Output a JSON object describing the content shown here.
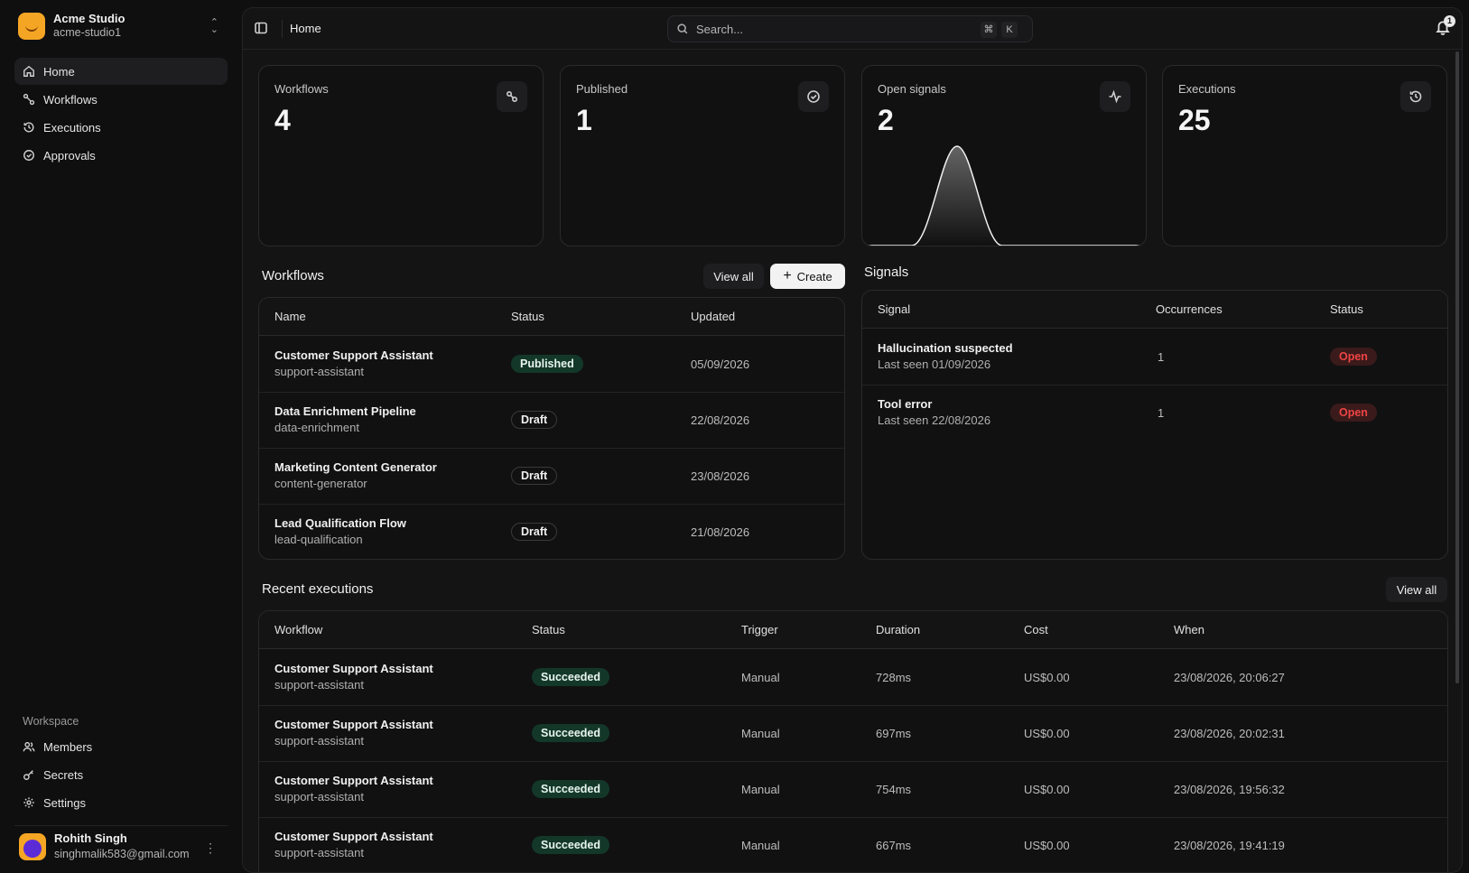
{
  "team": {
    "name": "Acme Studio",
    "slug": "acme-studio1"
  },
  "nav": [
    {
      "label": "Home",
      "icon": "home-icon",
      "active": true
    },
    {
      "label": "Workflows",
      "icon": "workflow-icon"
    },
    {
      "label": "Executions",
      "icon": "history-icon"
    },
    {
      "label": "Approvals",
      "icon": "check-circle-icon"
    }
  ],
  "workspace": {
    "label": "Workspace",
    "items": [
      {
        "label": "Members",
        "icon": "users-icon"
      },
      {
        "label": "Secrets",
        "icon": "key-icon"
      },
      {
        "label": "Settings",
        "icon": "gear-icon"
      }
    ]
  },
  "user": {
    "name": "Rohith Singh",
    "email": "singhmalik583@gmail.com"
  },
  "topbar": {
    "breadcrumb": "Home",
    "search_placeholder": "Search...",
    "kbd1": "⌘",
    "kbd2": "K",
    "notifications": "1"
  },
  "stats": [
    {
      "label": "Workflows",
      "value": "4",
      "icon": "workflow-icon"
    },
    {
      "label": "Published",
      "value": "1",
      "icon": "check-circle-icon"
    },
    {
      "label": "Open signals",
      "value": "2",
      "icon": "activity-icon"
    },
    {
      "label": "Executions",
      "value": "25",
      "icon": "history-icon"
    }
  ],
  "workflows": {
    "title": "Workflows",
    "view_all": "View all",
    "create": "Create",
    "headers": [
      "Name",
      "Status",
      "Updated"
    ],
    "rows": [
      {
        "name": "Customer Support Assistant",
        "slug": "support-assistant",
        "status": "Published",
        "updated": "05/09/2026"
      },
      {
        "name": "Data Enrichment Pipeline",
        "slug": "data-enrichment",
        "status": "Draft",
        "updated": "22/08/2026"
      },
      {
        "name": "Marketing Content Generator",
        "slug": "content-generator",
        "status": "Draft",
        "updated": "23/08/2026"
      },
      {
        "name": "Lead Qualification Flow",
        "slug": "lead-qualification",
        "status": "Draft",
        "updated": "21/08/2026"
      }
    ]
  },
  "signals": {
    "title": "Signals",
    "headers": [
      "Signal",
      "Occurrences",
      "Status"
    ],
    "rows": [
      {
        "name": "Hallucination suspected",
        "last_seen": "Last seen 01/09/2026",
        "occurrences": "1",
        "status": "Open"
      },
      {
        "name": "Tool error",
        "last_seen": "Last seen 22/08/2026",
        "occurrences": "1",
        "status": "Open"
      }
    ]
  },
  "executions": {
    "title": "Recent executions",
    "view_all": "View all",
    "headers": [
      "Workflow",
      "Status",
      "Trigger",
      "Duration",
      "Cost",
      "When"
    ],
    "rows": [
      {
        "name": "Customer Support Assistant",
        "slug": "support-assistant",
        "status": "Succeeded",
        "trigger": "Manual",
        "duration": "728ms",
        "cost": "US$0.00",
        "when": "23/08/2026, 20:06:27"
      },
      {
        "name": "Customer Support Assistant",
        "slug": "support-assistant",
        "status": "Succeeded",
        "trigger": "Manual",
        "duration": "697ms",
        "cost": "US$0.00",
        "when": "23/08/2026, 20:02:31"
      },
      {
        "name": "Customer Support Assistant",
        "slug": "support-assistant",
        "status": "Succeeded",
        "trigger": "Manual",
        "duration": "754ms",
        "cost": "US$0.00",
        "when": "23/08/2026, 19:56:32"
      },
      {
        "name": "Customer Support Assistant",
        "slug": "support-assistant",
        "status": "Succeeded",
        "trigger": "Manual",
        "duration": "667ms",
        "cost": "US$0.00",
        "when": "23/08/2026, 19:41:19"
      }
    ]
  },
  "colors": {
    "published": "#13382a",
    "open": "#ef4444",
    "accent": "#f5a524"
  }
}
